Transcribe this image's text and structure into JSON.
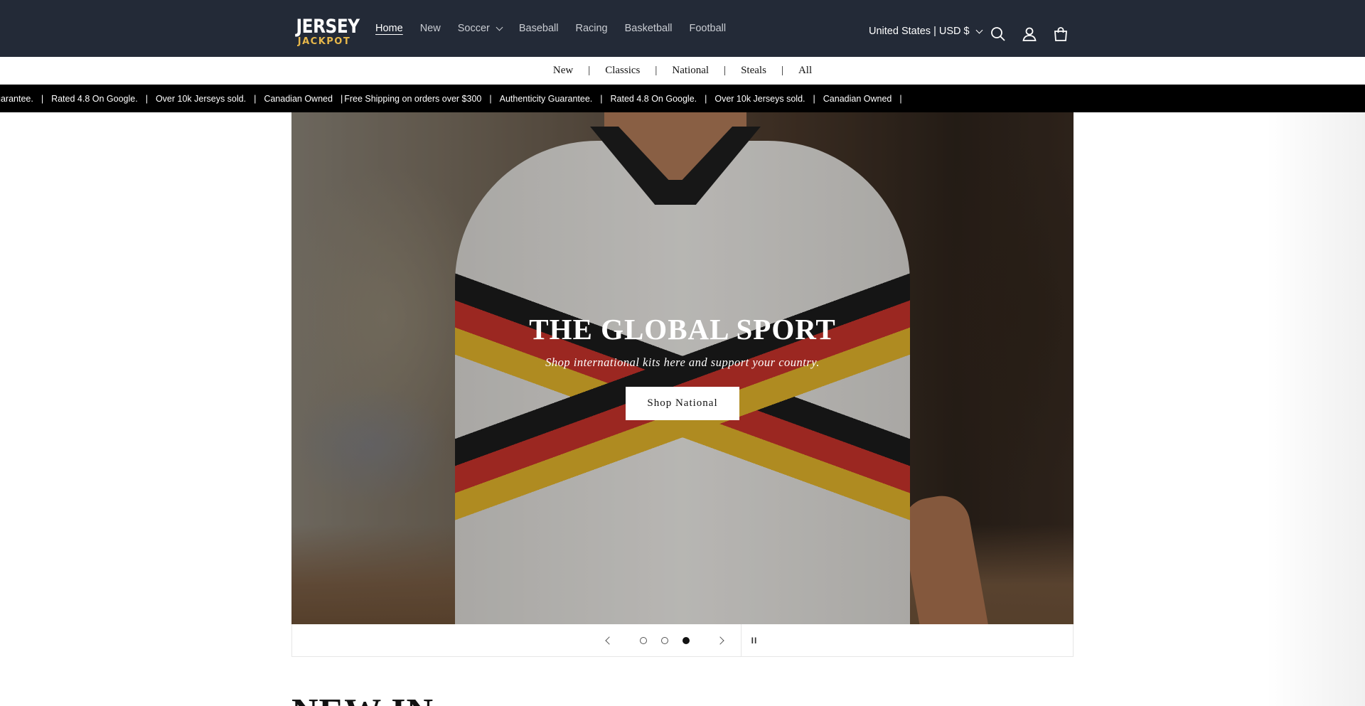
{
  "header": {
    "logo": {
      "line1": "JERSEY",
      "line2": "JACKPOT"
    },
    "nav": [
      {
        "label": "Home",
        "active": true,
        "dropdown": false
      },
      {
        "label": "New",
        "active": false,
        "dropdown": false
      },
      {
        "label": "Soccer",
        "active": false,
        "dropdown": true
      },
      {
        "label": "Baseball",
        "active": false,
        "dropdown": false
      },
      {
        "label": "Racing",
        "active": false,
        "dropdown": false
      },
      {
        "label": "Basketball",
        "active": false,
        "dropdown": false
      },
      {
        "label": "Football",
        "active": false,
        "dropdown": false
      }
    ],
    "localization": "United States | USD $",
    "icons": [
      "search-icon",
      "account-icon",
      "cart-icon"
    ],
    "background": "#232a37"
  },
  "submenu": {
    "items": [
      "New",
      "Classics",
      "National",
      "Steals",
      "All"
    ],
    "separator": "|"
  },
  "announcement": {
    "items": [
      "uarantee.",
      "Rated 4.8 On Google.",
      "Over 10k Jerseys sold.",
      "Canadian Owned",
      "Free Shipping on orders over $300",
      "Authenticity Guarantee.",
      "Rated 4.8 On Google.",
      "Over 10k Jerseys sold.",
      "Canadian Owned"
    ],
    "separator": "|"
  },
  "hero": {
    "title": "THE GLOBAL SPORT",
    "subtitle": "Shop international kits here and support your country.",
    "button": "Shop National",
    "slides_total": 3,
    "active_slide": 3
  },
  "slider": {
    "prev_icon": "chevron-left-icon",
    "next_icon": "chevron-right-icon",
    "pause_label": "II"
  },
  "section": {
    "heading": "NEW IN"
  }
}
